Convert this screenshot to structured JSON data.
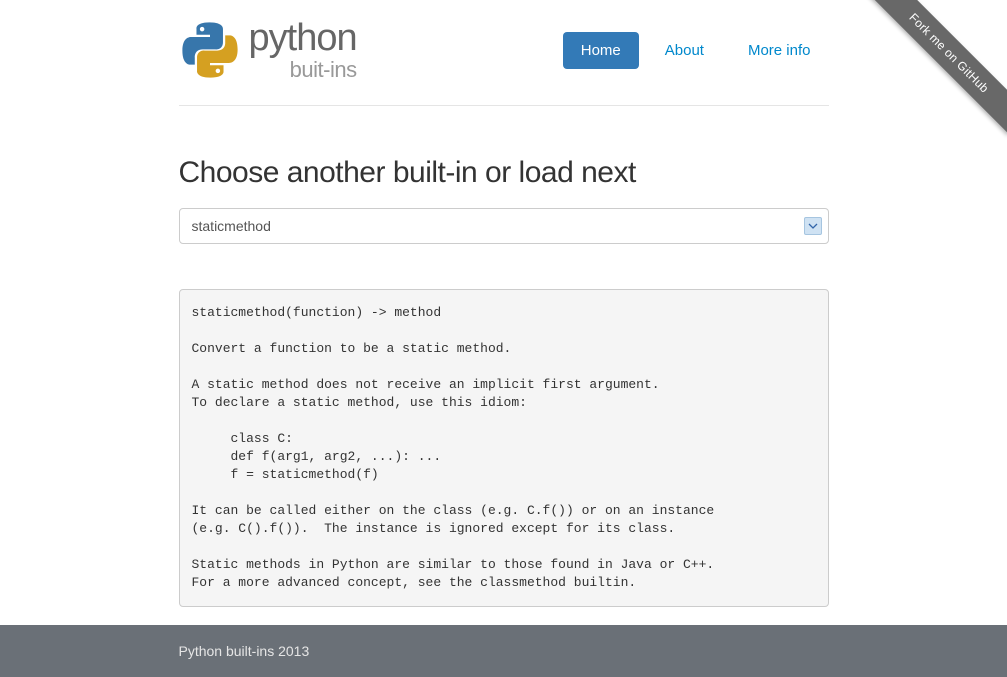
{
  "logo": {
    "main": "python",
    "sub": "buit-ins"
  },
  "nav": {
    "items": [
      {
        "label": "Home",
        "active": true
      },
      {
        "label": "About",
        "active": false
      },
      {
        "label": "More info",
        "active": false
      }
    ]
  },
  "page": {
    "title": "Choose another built-in or load next",
    "selected": "staticmethod"
  },
  "doc": "staticmethod(function) -> method\n\nConvert a function to be a static method.\n\nA static method does not receive an implicit first argument.\nTo declare a static method, use this idiom:\n\n     class C:\n     def f(arg1, arg2, ...): ...\n     f = staticmethod(f)\n\nIt can be called either on the class (e.g. C.f()) or on an instance\n(e.g. C().f()).  The instance is ignored except for its class.\n\nStatic methods in Python are similar to those found in Java or C++.\nFor a more advanced concept, see the classmethod builtin.",
  "footer": {
    "text": "Python built-ins 2013"
  },
  "ribbon": {
    "text": "Fork me on GitHub"
  }
}
